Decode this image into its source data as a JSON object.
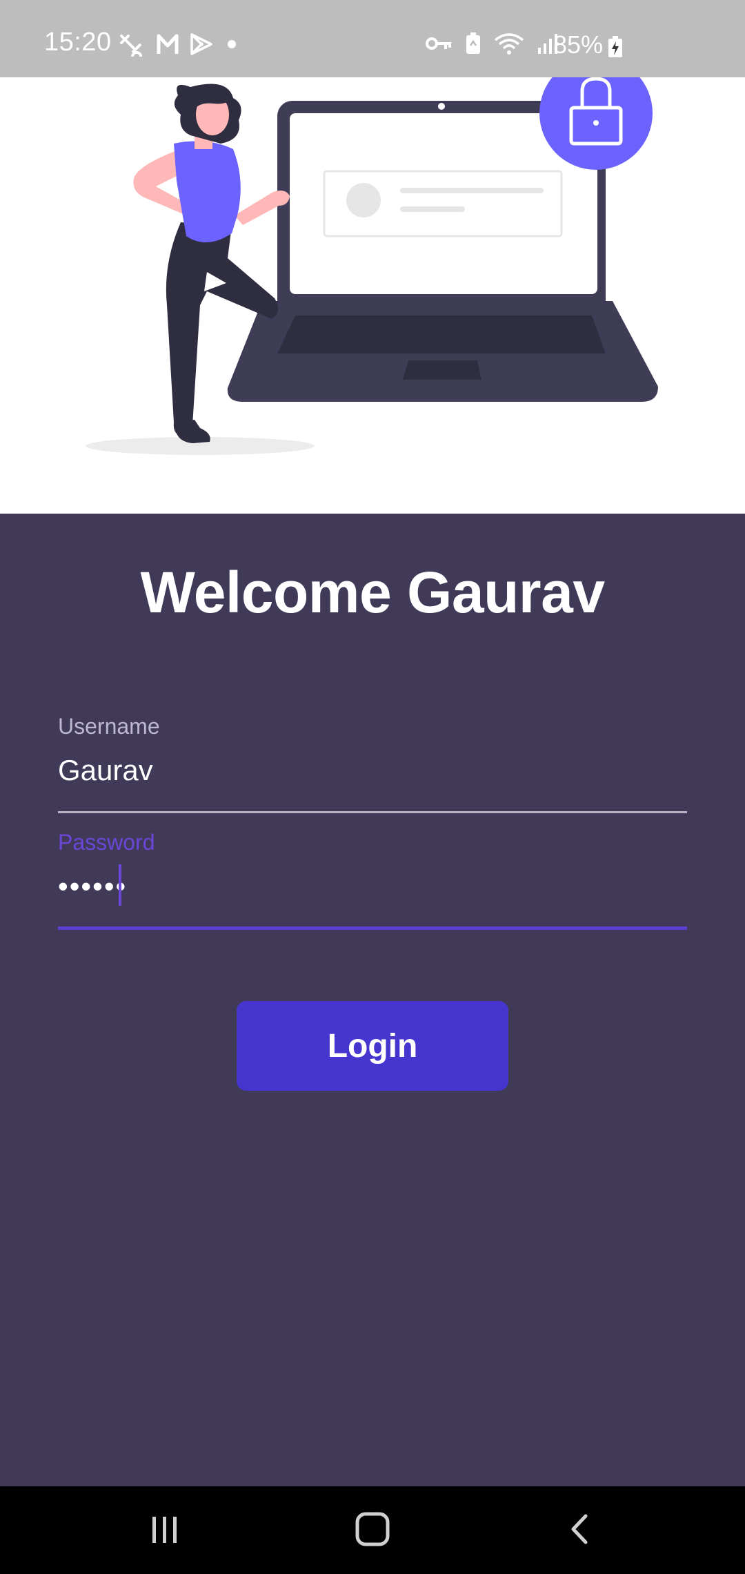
{
  "status_bar": {
    "time": "15:20",
    "battery_percent": "85%",
    "left_icons": [
      "tool-icon",
      "gmail-icon",
      "play-store-icon",
      "dot-icon"
    ],
    "right_icons": [
      "vpn-key-icon",
      "battery-saver-icon",
      "wifi-icon",
      "signal-icon"
    ]
  },
  "hero": {
    "illustration": "woman-with-laptop-lock-illustration",
    "colors": {
      "accent": "#6c63ff",
      "dark": "#3f3d56"
    }
  },
  "login": {
    "title": "Welcome Gaurav",
    "username_label": "Username",
    "username_value": "Gaurav",
    "password_label": "Password",
    "password_value": "••••••",
    "button_label": "Login"
  },
  "nav_bar": {
    "buttons": [
      "recents-icon",
      "home-icon",
      "back-icon"
    ]
  },
  "colors": {
    "background": "#403a58",
    "focus": "#6a47d8",
    "button": "#4735cf",
    "status_bar": "#bdbdbd"
  }
}
